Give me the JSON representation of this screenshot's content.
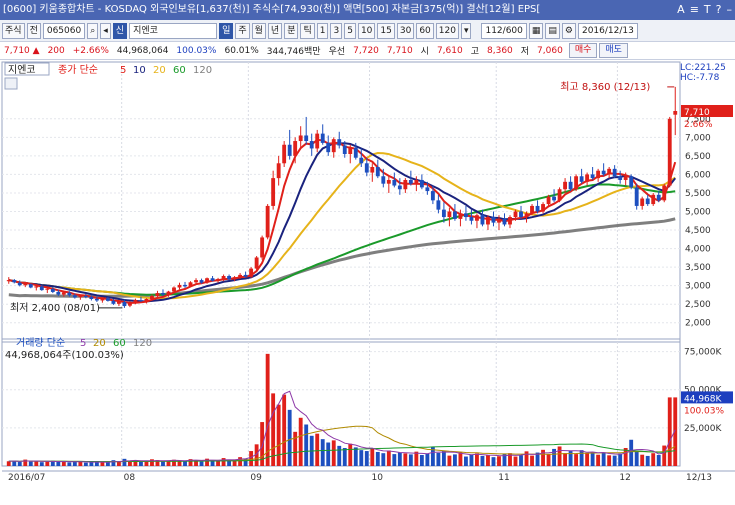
{
  "window": {
    "title": "[0600] 키움종합차트 - KOSDAQ 외국인보유[1,637(천)] 주식수[74,930(천)] 액면[500] 자본금[375(억)] 결산[12월] EPS[",
    "icons": [
      "A",
      "≡",
      "T",
      "?",
      "–"
    ]
  },
  "toolbar": {
    "type_label": "주식",
    "prefix_label": "전",
    "code_value": "065060",
    "credit_badge": "신",
    "name_value": "지엔코",
    "period_active": "일",
    "periods": [
      "주",
      "월",
      "년",
      "분",
      "틱"
    ],
    "minute_steps": [
      "1",
      "3",
      "5",
      "10",
      "15",
      "30",
      "60",
      "120"
    ],
    "page_counter": "112/600",
    "date_value": "2016/12/13"
  },
  "quote": {
    "price": "7,710 ▲",
    "change": "200",
    "change_pct": "+2.66%",
    "volume": "44,968,064",
    "volume_ratio": "100.03%",
    "turnover": "60.01%",
    "amount": "344,746백만",
    "pref_label": "우선",
    "pref_value": "7,720",
    "prev_value": "7,710",
    "open_label": "시",
    "open_value": "7,610",
    "high_label": "고",
    "high_value": "8,360",
    "low_label": "저",
    "low_value": "7,060",
    "buy_label": "매수",
    "sell_label": "매도"
  },
  "price_legend": {
    "name": "지엔코",
    "prefix": "종가 단순",
    "ma_periods": [
      "5",
      "10",
      "20",
      "60",
      "120"
    ]
  },
  "volume_legend": {
    "prefix": "거래량 단순",
    "ma_periods": [
      "5",
      "20",
      "60",
      "120"
    ],
    "value_text": "44,968,064주(100.03%)"
  },
  "annotations": {
    "high": "최고 8,360 (12/13)",
    "low": "최저 2,400 (08/01)",
    "lc": "LC:221.25",
    "hc": "HC:-7.78",
    "price_tag": "7,710",
    "price_tag_pct": "2.66%",
    "vol_tag": "44,968K",
    "vol_tag_pct": "100.03%"
  },
  "colors": {
    "ma5": "#e0201a",
    "ma10": "#1a237e",
    "ma20": "#e6b31a",
    "ma60": "#1a9a2a",
    "ma120": "#7f7f7f",
    "up": "#e0201a",
    "down": "#1d4fbf"
  },
  "chart_data": {
    "type": "candlestick",
    "price_axis": {
      "ticks": [
        2000,
        2500,
        3000,
        3500,
        4000,
        4500,
        5000,
        5500,
        6000,
        6500,
        7000,
        7500
      ],
      "tick_labels": [
        "2,000",
        "2,500",
        "3,000",
        "3,500",
        "4,000",
        "4,500",
        "5,000",
        "5,500",
        "6,000",
        "6,500",
        "7,000",
        "7,500"
      ],
      "range": [
        1750,
        8600
      ]
    },
    "volume_axis": {
      "ticks": [
        25000,
        50000,
        75000
      ],
      "tick_labels": [
        "25,000K",
        "50,000K",
        "75,000K"
      ],
      "range": [
        0,
        78000
      ]
    },
    "x_labels": [
      "2016/07",
      "08",
      "09",
      "10",
      "11",
      "12",
      "12/13"
    ],
    "x_label_index": [
      0,
      21,
      44,
      66,
      89,
      111,
      125
    ],
    "candles": [
      [
        3120,
        3230,
        3050,
        3150
      ],
      [
        3150,
        3180,
        3060,
        3090
      ],
      [
        3080,
        3140,
        2980,
        3010
      ],
      [
        3010,
        3090,
        2960,
        3050
      ],
      [
        3040,
        3060,
        2930,
        2950
      ],
      [
        2950,
        3010,
        2870,
        2980
      ],
      [
        2980,
        3020,
        2860,
        2880
      ],
      [
        2890,
        2950,
        2800,
        2920
      ],
      [
        2910,
        2960,
        2800,
        2830
      ],
      [
        2830,
        2890,
        2720,
        2760
      ],
      [
        2760,
        2860,
        2700,
        2820
      ],
      [
        2810,
        2850,
        2700,
        2740
      ],
      [
        2740,
        2790,
        2650,
        2680
      ],
      [
        2690,
        2760,
        2620,
        2720
      ],
      [
        2720,
        2780,
        2660,
        2700
      ],
      [
        2700,
        2730,
        2600,
        2640
      ],
      [
        2640,
        2700,
        2560,
        2600
      ],
      [
        2600,
        2680,
        2540,
        2660
      ],
      [
        2660,
        2700,
        2570,
        2590
      ],
      [
        2590,
        2640,
        2480,
        2510
      ],
      [
        2510,
        2600,
        2450,
        2570
      ],
      [
        2560,
        2620,
        2400,
        2450
      ],
      [
        2460,
        2580,
        2420,
        2550
      ],
      [
        2550,
        2650,
        2500,
        2610
      ],
      [
        2610,
        2700,
        2560,
        2580
      ],
      [
        2580,
        2660,
        2520,
        2640
      ],
      [
        2640,
        2760,
        2610,
        2720
      ],
      [
        2720,
        2860,
        2680,
        2800
      ],
      [
        2800,
        2900,
        2720,
        2760
      ],
      [
        2760,
        2860,
        2700,
        2840
      ],
      [
        2840,
        2980,
        2800,
        2950
      ],
      [
        2950,
        3080,
        2900,
        3020
      ],
      [
        3020,
        3100,
        2940,
        2980
      ],
      [
        2980,
        3120,
        2950,
        3090
      ],
      [
        3090,
        3200,
        3040,
        3150
      ],
      [
        3150,
        3190,
        3050,
        3080
      ],
      [
        3080,
        3220,
        3050,
        3200
      ],
      [
        3200,
        3260,
        3110,
        3130
      ],
      [
        3130,
        3210,
        3080,
        3180
      ],
      [
        3180,
        3300,
        3120,
        3260
      ],
      [
        3260,
        3300,
        3150,
        3170
      ],
      [
        3170,
        3260,
        3120,
        3230
      ],
      [
        3230,
        3340,
        3180,
        3290
      ],
      [
        3290,
        3380,
        3220,
        3240
      ],
      [
        3240,
        3500,
        3200,
        3460
      ],
      [
        3460,
        3800,
        3420,
        3760
      ],
      [
        3760,
        4350,
        3700,
        4300
      ],
      [
        4300,
        5200,
        4250,
        5150
      ],
      [
        5150,
        6100,
        5050,
        5900
      ],
      [
        5900,
        6500,
        5700,
        6300
      ],
      [
        6300,
        6900,
        6200,
        6800
      ],
      [
        6800,
        7200,
        6400,
        6500
      ],
      [
        6500,
        7000,
        6300,
        6900
      ],
      [
        6900,
        7300,
        6700,
        7050
      ],
      [
        7050,
        7550,
        6800,
        6900
      ],
      [
        6900,
        7100,
        6500,
        6700
      ],
      [
        6700,
        7200,
        6600,
        7100
      ],
      [
        7100,
        7350,
        6800,
        6850
      ],
      [
        6850,
        7050,
        6500,
        6600
      ],
      [
        6600,
        7000,
        6450,
        6950
      ],
      [
        6950,
        7150,
        6700,
        6780
      ],
      [
        6780,
        6900,
        6450,
        6550
      ],
      [
        6550,
        6800,
        6300,
        6720
      ],
      [
        6720,
        6850,
        6400,
        6450
      ],
      [
        6450,
        6700,
        6200,
        6300
      ],
      [
        6300,
        6450,
        5950,
        6050
      ],
      [
        6050,
        6300,
        5800,
        6200
      ],
      [
        6200,
        6400,
        5900,
        5950
      ],
      [
        5950,
        6150,
        5650,
        5750
      ],
      [
        5750,
        5950,
        5500,
        5850
      ],
      [
        5850,
        6050,
        5650,
        5700
      ],
      [
        5700,
        5900,
        5450,
        5600
      ],
      [
        5600,
        5900,
        5500,
        5850
      ],
      [
        5850,
        6100,
        5700,
        5750
      ],
      [
        5750,
        5950,
        5550,
        5850
      ],
      [
        5850,
        6000,
        5600,
        5650
      ],
      [
        5650,
        5800,
        5450,
        5550
      ],
      [
        5550,
        5700,
        5200,
        5300
      ],
      [
        5300,
        5450,
        4950,
        5050
      ],
      [
        5050,
        5250,
        4700,
        4850
      ],
      [
        4850,
        5100,
        4600,
        5000
      ],
      [
        5000,
        5200,
        4750,
        4800
      ],
      [
        4800,
        5050,
        4600,
        4950
      ],
      [
        4950,
        5150,
        4750,
        4850
      ],
      [
        4850,
        5050,
        4650,
        4750
      ],
      [
        4750,
        4950,
        4550,
        4900
      ],
      [
        4900,
        5050,
        4600,
        4650
      ],
      [
        4650,
        4900,
        4500,
        4850
      ],
      [
        4850,
        5000,
        4600,
        4700
      ],
      [
        4700,
        4900,
        4500,
        4800
      ],
      [
        4800,
        4950,
        4600,
        4650
      ],
      [
        4650,
        4900,
        4550,
        4850
      ],
      [
        4850,
        5050,
        4750,
        5000
      ],
      [
        5000,
        5150,
        4800,
        4850
      ],
      [
        4850,
        5000,
        4700,
        4950
      ],
      [
        4950,
        5200,
        4900,
        5150
      ],
      [
        5150,
        5300,
        4950,
        5000
      ],
      [
        5000,
        5250,
        4950,
        5200
      ],
      [
        5200,
        5450,
        5150,
        5400
      ],
      [
        5400,
        5600,
        5250,
        5300
      ],
      [
        5300,
        5650,
        5250,
        5600
      ],
      [
        5600,
        5900,
        5500,
        5800
      ],
      [
        5800,
        5950,
        5550,
        5600
      ],
      [
        5600,
        6000,
        5550,
        5950
      ],
      [
        5950,
        6150,
        5750,
        5800
      ],
      [
        5800,
        6050,
        5700,
        6000
      ],
      [
        6000,
        6200,
        5850,
        5900
      ],
      [
        5900,
        6150,
        5800,
        6100
      ],
      [
        6100,
        6300,
        5950,
        6000
      ],
      [
        6000,
        6200,
        5900,
        6150
      ],
      [
        6150,
        6250,
        5900,
        5950
      ],
      [
        5950,
        6100,
        5750,
        5850
      ],
      [
        5850,
        6050,
        5700,
        5950
      ],
      [
        5950,
        6000,
        5600,
        5650
      ],
      [
        5650,
        5750,
        5050,
        5150
      ],
      [
        5150,
        5400,
        5050,
        5350
      ],
      [
        5350,
        5450,
        5150,
        5200
      ],
      [
        5200,
        5500,
        5150,
        5450
      ],
      [
        5450,
        5550,
        5250,
        5300
      ],
      [
        5300,
        5750,
        5250,
        5700
      ],
      [
        5700,
        7550,
        5650,
        7500
      ],
      [
        7610,
        8360,
        7060,
        7710
      ]
    ],
    "volume": [
      3100,
      3400,
      2600,
      4200,
      2900,
      3300,
      2500,
      2800,
      3500,
      2700,
      3000,
      2400,
      2600,
      3100,
      2200,
      2500,
      2800,
      2300,
      2600,
      3800,
      2900,
      4700,
      3200,
      3600,
      2800,
      3100,
      4400,
      3900,
      3000,
      3400,
      4100,
      3600,
      3300,
      4500,
      3900,
      2900,
      4800,
      3300,
      3700,
      5200,
      3600,
      4300,
      5800,
      4900,
      9800,
      14200,
      28800,
      73500,
      47600,
      40200,
      46800,
      36800,
      22400,
      31600,
      27200,
      19800,
      21200,
      17600,
      15400,
      16800,
      13200,
      11800,
      14600,
      12200,
      10400,
      9800,
      11600,
      9200,
      8400,
      10200,
      7800,
      8800,
      8200,
      7600,
      9400,
      7200,
      8000,
      12400,
      8600,
      9800,
      6800,
      7600,
      9000,
      6200,
      7400,
      8200,
      6600,
      7200,
      5800,
      6400,
      7800,
      8400,
      6200,
      7000,
      9600,
      6800,
      8800,
      10600,
      7600,
      11200,
      12800,
      8400,
      9800,
      7800,
      10400,
      8600,
      9200,
      7400,
      8800,
      7000,
      6800,
      8200,
      11800,
      17200,
      9600,
      7400,
      6600,
      8400,
      7200,
      13400,
      44968,
      44968
    ]
  }
}
